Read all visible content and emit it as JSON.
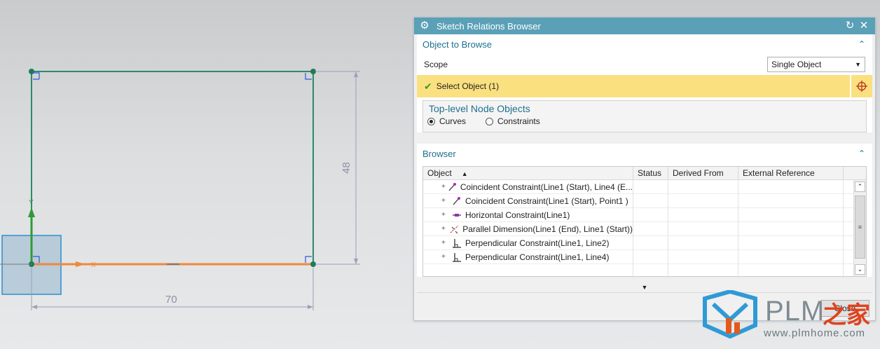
{
  "canvas": {
    "dim_width": "70",
    "dim_height": "48",
    "axis_y": "Y",
    "axis_x": "X"
  },
  "dialog": {
    "title": "Sketch Relations Browser",
    "reset_icon": "reset-icon",
    "close_icon": "close-icon",
    "object_section": {
      "header": "Object to Browse",
      "scope_label": "Scope",
      "scope_value": "Single Object",
      "select_object": "Select Object (1)",
      "group_title": "Top-level Node Objects",
      "radio_curves": "Curves",
      "radio_constraints": "Constraints",
      "selected_radio": "Curves"
    },
    "browser_section": {
      "header": "Browser",
      "columns": [
        "Object",
        "Status",
        "Derived From",
        "External Reference"
      ],
      "rows": [
        {
          "icon": "coincident-icon",
          "label": "Coincident Constraint(Line1 (Start), Line4 (E..."
        },
        {
          "icon": "coincident-icon",
          "label": "Coincident Constraint(Line1 (Start), Point1 )"
        },
        {
          "icon": "horizontal-icon",
          "label": "Horizontal Constraint(Line1)"
        },
        {
          "icon": "parallel-dimension-icon",
          "label": "Parallel Dimension(Line1 (End), Line1 (Start))"
        },
        {
          "icon": "perpendicular-icon",
          "label": "Perpendicular Constraint(Line1, Line2)"
        },
        {
          "icon": "perpendicular-icon",
          "label": "Perpendicular Constraint(Line1, Line4)"
        }
      ]
    },
    "close_label": "Close"
  },
  "watermark": {
    "brand": "PLM",
    "brand_cn": "之家",
    "url": "www.plmhome.com"
  },
  "colors": {
    "titlebar": "#5aa0b7",
    "sketch_line": "#2e8a6a",
    "x_axis": "#f0883a",
    "y_axis": "#2f9a36",
    "highlight": "#fbe07f",
    "section_header": "#1e6f8e"
  }
}
